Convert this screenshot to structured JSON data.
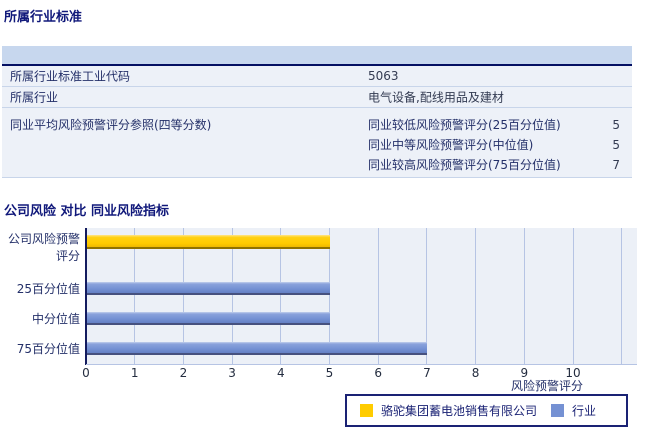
{
  "section_industry": {
    "title": "所属行业标准",
    "rows": [
      {
        "label": "所属行业标准工业代码",
        "value": "5063"
      },
      {
        "label": "所属行业",
        "value": "电气设备,配线用品及建材"
      }
    ],
    "group": {
      "label": "同业平均风险预警评分参照(四等分数)",
      "sub_rows": [
        {
          "label": "同业较低风险预警评分(25百分位值)",
          "value": "5"
        },
        {
          "label": "同业中等风险预警评分(中位值)",
          "value": "5"
        },
        {
          "label": "同业较高风险预警评分(75百分位值)",
          "value": "7"
        }
      ]
    }
  },
  "section_chart": {
    "title": "公司风险 对比 同业风险指标"
  },
  "chart_data": {
    "type": "bar",
    "orientation": "horizontal",
    "categories": [
      "公司风险预警评分",
      "25百分位值",
      "中分位值",
      "75百分位值"
    ],
    "values": [
      5,
      5,
      5,
      7
    ],
    "series": [
      {
        "name": "骆驼集团蓄电池销售有限公司",
        "color": "#ffcc00",
        "category_indexes": [
          0
        ]
      },
      {
        "name": "行业",
        "color": "#7591d3",
        "category_indexes": [
          1,
          2,
          3
        ]
      }
    ],
    "xlabel": "风险预警评分",
    "xlim": [
      0,
      11.3
    ],
    "x_ticks": [
      0,
      1,
      2,
      3,
      4,
      5,
      6,
      7,
      8,
      9,
      10
    ],
    "grid": true,
    "legend_position": "bottom-right"
  },
  "colors": {
    "company_bar": "#ffcc00",
    "industry_bar": "#7591d3",
    "table_header_band": "#c7d7ee",
    "header_rule": "#041063",
    "row_bg": "#edf1f8",
    "row_separator": "#c8d5ea",
    "plot_bg": "#ecf0f7",
    "gridline": "#b6c4e4",
    "axis": "#131b5e",
    "title_text": "#10187a",
    "body_text": "#243069"
  }
}
